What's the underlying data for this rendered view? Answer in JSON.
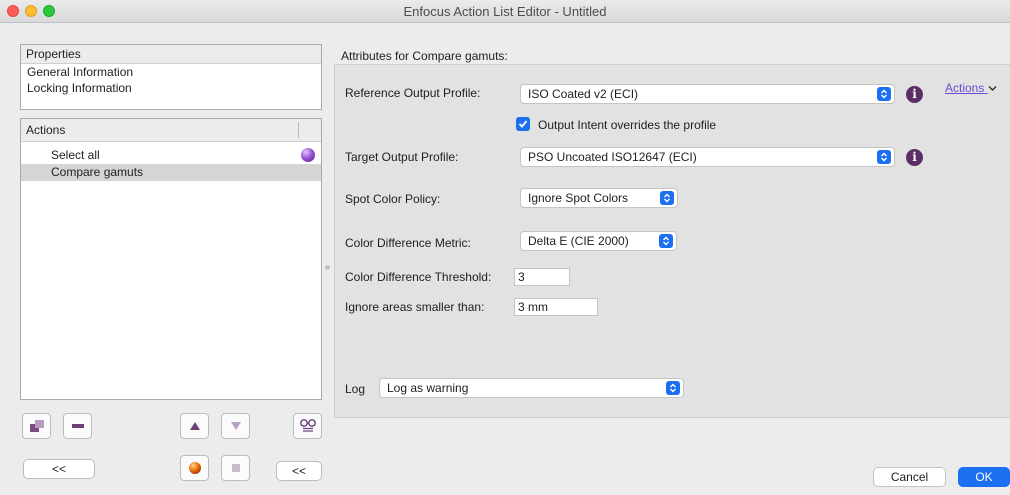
{
  "window": {
    "title": "Enfocus Action List Editor - Untitled"
  },
  "properties": {
    "header": "Properties",
    "items": [
      "General Information",
      "Locking Information"
    ]
  },
  "actions_panel": {
    "header": "Actions",
    "items": [
      {
        "label": "Select all",
        "selected": false
      },
      {
        "label": "Compare gamuts",
        "selected": true
      }
    ],
    "collapse_label": "<<",
    "collapse_label_2": "<<"
  },
  "attributes": {
    "title": "Attributes for Compare gamuts:",
    "actions_link": "Actions",
    "reference_profile": {
      "label": "Reference Output Profile:",
      "value": "ISO Coated v2 (ECI)"
    },
    "output_intent": {
      "label": "Output Intent overrides the profile",
      "checked": true
    },
    "target_profile": {
      "label": "Target Output Profile:",
      "value": "PSO Uncoated ISO12647 (ECI)"
    },
    "spot_color_policy": {
      "label": "Spot Color Policy:",
      "value": "Ignore Spot Colors"
    },
    "color_difference_metric": {
      "label": "Color Difference Metric:",
      "value": "Delta E (CIE 2000)"
    },
    "color_difference_threshold": {
      "label": "Color Difference Threshold:",
      "value": "3"
    },
    "ignore_areas": {
      "label": "Ignore areas smaller than:",
      "value": "3 mm"
    },
    "log": {
      "label": "Log",
      "value": "Log as warning"
    }
  },
  "footer": {
    "cancel": "Cancel",
    "ok": "OK"
  },
  "colors": {
    "accent": "#1d6ff2",
    "info_icon": "#5b2e66",
    "link": "#6b4bd6"
  }
}
